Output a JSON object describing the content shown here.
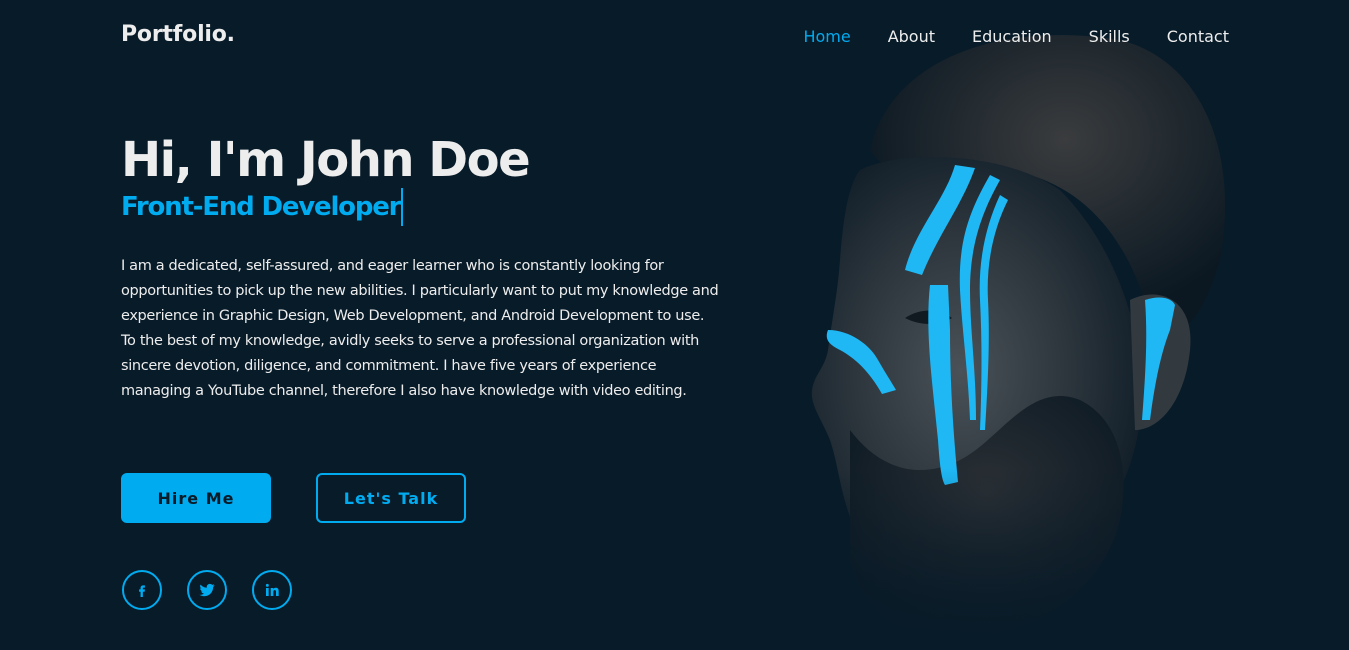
{
  "header": {
    "logo": "Portfolio.",
    "nav": [
      {
        "label": "Home",
        "active": true
      },
      {
        "label": "About",
        "active": false
      },
      {
        "label": "Education",
        "active": false
      },
      {
        "label": "Skills",
        "active": false
      },
      {
        "label": "Contact",
        "active": false
      }
    ]
  },
  "home": {
    "title": "Hi, I'm John Doe",
    "subtitle": "Front-End Developer",
    "description": "I am a dedicated, self-assured, and eager learner who is constantly looking for opportunities to pick up the new abilities. I particularly want to put my knowledge and experience in Graphic Design, Web Development, and Android Development to use. To the best of my knowledge, avidly seeks to serve a professional organization with sincere devotion, diligence, and commitment. I have five years of experience managing a YouTube channel, therefore I also have knowledge with video editing.",
    "buttons": {
      "hire_label": "Hire Me",
      "talk_label": "Let's Talk"
    },
    "socials": [
      {
        "icon": "facebook-icon"
      },
      {
        "icon": "twitter-icon"
      },
      {
        "icon": "linkedin-icon"
      }
    ]
  },
  "colors": {
    "background": "#081b29",
    "accent": "#00abf0",
    "text": "#ededed"
  }
}
